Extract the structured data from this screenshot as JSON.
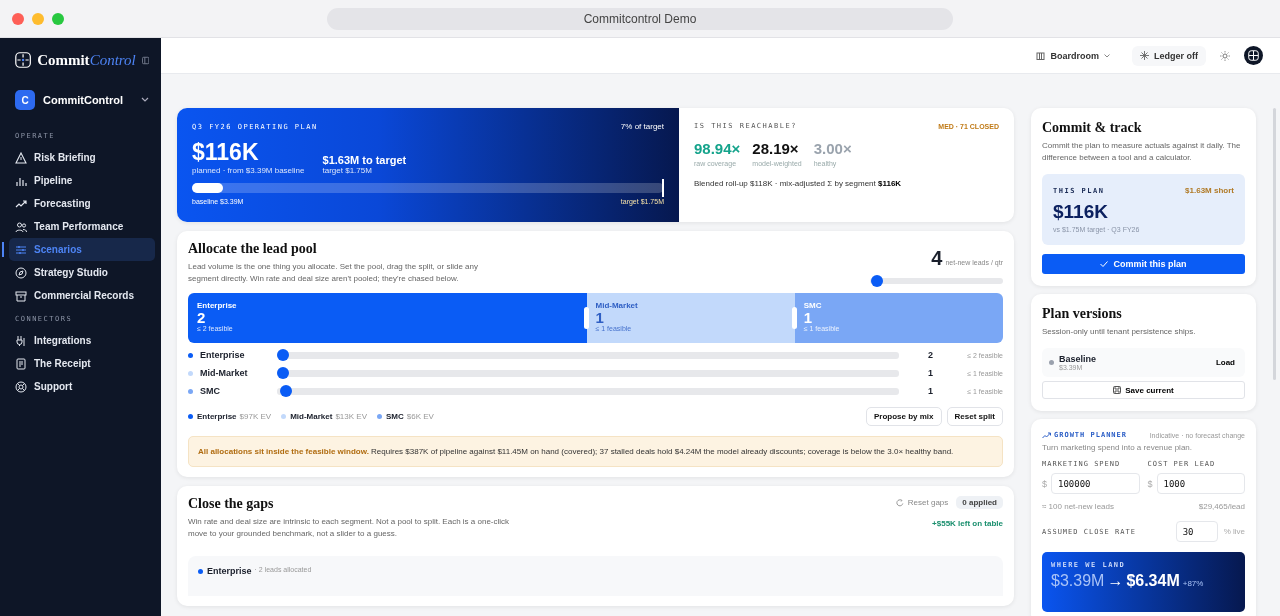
{
  "window": {
    "title": "Commitcontrol Demo"
  },
  "sidebar": {
    "brand": {
      "part_1": "Commit",
      "part_2": "Control"
    },
    "workspace": {
      "initial": "C",
      "name": "CommitControl"
    },
    "sections": [
      {
        "label": "OPERATE",
        "items": [
          {
            "label": "Risk Briefing",
            "selected": false
          },
          {
            "label": "Pipeline",
            "selected": false
          },
          {
            "label": "Forecasting",
            "selected": false
          },
          {
            "label": "Team Performance",
            "selected": false
          },
          {
            "label": "Scenarios",
            "selected": true
          },
          {
            "label": "Strategy Studio",
            "selected": false
          },
          {
            "label": "Commercial Records",
            "selected": false
          }
        ]
      },
      {
        "label": "CONNECTORS",
        "items": [
          {
            "label": "Integrations",
            "selected": false
          },
          {
            "label": "The Receipt",
            "selected": false
          },
          {
            "label": "Support",
            "selected": false
          }
        ]
      }
    ]
  },
  "header": {
    "view": "Boardroom",
    "ledger": "Ledger off"
  },
  "plan": {
    "eyebrow": "Q3 FY26 OPERATING PLAN",
    "percent": "7% of target",
    "amount": "$116K",
    "amount_note": "planned · from $3.39M baseline",
    "gap": "$1.63M to target",
    "gap_note": "target $1.75M",
    "progress": {
      "level": 0.066
    },
    "baseline_label": "baseline $3.39M",
    "target_label": "target $1.75M"
  },
  "reachable": {
    "eyebrow": "IS THIS REACHABLE?",
    "badge": "MED · 71 CLOSED",
    "metrics": [
      {
        "value": "98.94×",
        "label": "raw coverage",
        "color": "#14a38b"
      },
      {
        "value": "28.19×",
        "label": "model-weighted",
        "color": "#111111"
      },
      {
        "value": "3.00×",
        "label": "healthy",
        "color": "#9aa3ad"
      }
    ],
    "summary": "Blended roll-up $118K · mix-adjusted Σ by segment **$116K**"
  },
  "allocate": {
    "title": "Allocate the lead pool",
    "description": "Lead volume is the one thing you allocate. Set the pool, drag the split, or slide any segment directly. Win rate and deal size aren't pooled; they're chased below.",
    "pool": {
      "value": "4",
      "unit": "net-new leads / qtr",
      "level": 0.05
    },
    "split": [
      {
        "name": "Enterprise",
        "value": "2",
        "feasible": "≤ 2 feasible",
        "color": "#0a5cf5"
      },
      {
        "name": "Mid-Market",
        "value": "1",
        "feasible": "≤ 1 feasible",
        "color": "#c2d9fb"
      },
      {
        "name": "SMC",
        "value": "1",
        "feasible": "≤ 1 feasible",
        "color": "#7aa7f5"
      }
    ],
    "segments": [
      {
        "name": "Enterprise",
        "value": "2",
        "feasible": "≤ 2 feasible",
        "color": "#0a5cf5",
        "level": 0.01
      },
      {
        "name": "Mid-Market",
        "value": "1",
        "feasible": "≤ 1 feasible",
        "color": "#c2d9fb",
        "level": 0.01
      },
      {
        "name": "SMC",
        "value": "1",
        "feasible": "≤ 1 feasible",
        "color": "#7aa7f5",
        "level": 0.015
      }
    ],
    "legend": [
      {
        "name": "Enterprise",
        "ev": "$97K EV",
        "color": "#0a5cf5"
      },
      {
        "name": "Mid-Market",
        "ev": "$13K EV",
        "color": "#c2d9fb"
      },
      {
        "name": "SMC",
        "ev": "$6K EV",
        "color": "#7aa7f5"
      }
    ],
    "buttons": [
      "Propose by mix",
      "Reset split"
    ],
    "notice": "**All allocations sit inside the feasible window.** Requires $387K of pipeline against $11.45M on hand (covered); 37 stalled deals hold $4.24M the model already discounts; coverage is below the 3.0× healthy band."
  },
  "gaps": {
    "title": "Close the gaps",
    "description": "Win rate and deal size are intrinsic to each segment. Not a pool to split. Each is a one-click move to your grounded benchmark, not a slider to a guess.",
    "reset": "Reset gaps",
    "applied": "0 applied",
    "left": "+$55K left on table",
    "segment": {
      "name": "Enterprise",
      "note": "· 2 leads allocated",
      "color": "#0a5cf5"
    }
  },
  "commit": {
    "title": "Commit & track",
    "description": "Commit the plan to measure actuals against it daily. The difference between a tool and a calculator.",
    "plan_label": "THIS PLAN",
    "short": "$1.63M short",
    "amount": "$116K",
    "note": "vs $1.75M target · Q3 FY26",
    "button": "Commit this plan"
  },
  "versions": {
    "title": "Plan versions",
    "description": "Session-only until tenant persistence ships.",
    "items": [
      {
        "name": "Baseline",
        "value": "$3.39M",
        "action": "Load"
      }
    ],
    "save": "Save current"
  },
  "growth": {
    "title": "GROWTH PLANNER",
    "note": "Indicative · no forecast change",
    "description": "Turn marketing spend into a revenue plan.",
    "fields": [
      {
        "label": "MARKETING SPEND",
        "prefix": "$",
        "value": "100000"
      },
      {
        "label": "COST PER LEAD",
        "prefix": "$",
        "value": "1000"
      }
    ],
    "leads": "≈ 100 net-new leads",
    "per_lead": "$29,465/lead",
    "close_rate": {
      "label": "ASSUMED CLOSE RATE",
      "value": "30",
      "suffix": "% live"
    },
    "landing": {
      "label": "WHERE WE LAND",
      "from": "$3.39M",
      "arrow": "→",
      "to": "$6.34M",
      "delta": "+87%"
    }
  }
}
